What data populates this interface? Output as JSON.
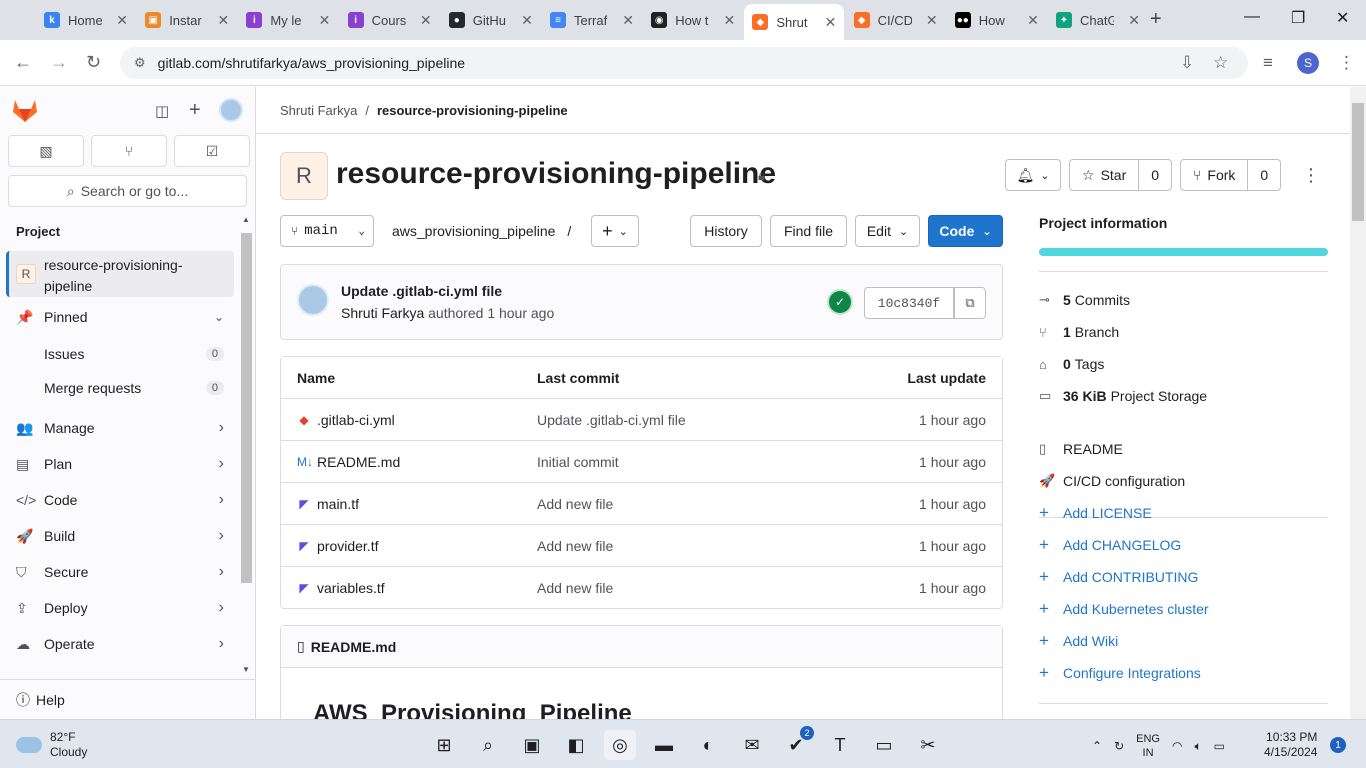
{
  "browser": {
    "tabs": [
      {
        "label": "Home",
        "icon": "k-icon",
        "color": "#3b82f6",
        "glyph": "k"
      },
      {
        "label": "Instar",
        "icon": "instance-icon",
        "color": "#ea8a2a",
        "glyph": "▣"
      },
      {
        "label": "My le",
        "icon": "learning-icon",
        "color": "#8b3fd1",
        "glyph": "i"
      },
      {
        "label": "Cours",
        "icon": "course-icon",
        "color": "#8b3fd1",
        "glyph": "i"
      },
      {
        "label": "GitHu",
        "icon": "github-icon",
        "color": "#24292f",
        "glyph": "●"
      },
      {
        "label": "Terraf",
        "icon": "docs-icon",
        "color": "#4285f4",
        "glyph": "≡"
      },
      {
        "label": "How t",
        "icon": "article-icon",
        "color": "#202124",
        "glyph": "◉"
      },
      {
        "label": "Shrut",
        "icon": "gitlab-icon",
        "color": "#fc6d26",
        "glyph": "◆"
      },
      {
        "label": "CI/CD",
        "icon": "gitlab-icon",
        "color": "#fc6d26",
        "glyph": "◆"
      },
      {
        "label": "How",
        "icon": "medium-icon",
        "color": "#000000",
        "glyph": "●●"
      },
      {
        "label": "ChatG",
        "icon": "chatgpt-icon",
        "color": "#10a37f",
        "glyph": "✦"
      }
    ],
    "active_tab": 7,
    "url": "gitlab.com/shrutifarkya/aws_provisioning_pipeline",
    "profile_initial": "S"
  },
  "sidebar": {
    "search_placeholder": "Search or go to...",
    "section_label": "Project",
    "project_badge": "R",
    "project_name": "resource-provisioning-pipeline",
    "pinned_label": "Pinned",
    "pinned_items": [
      {
        "label": "Issues",
        "count": "0"
      },
      {
        "label": "Merge requests",
        "count": "0"
      }
    ],
    "nav_items": [
      {
        "label": "Manage",
        "icon": "users-icon",
        "glyph": "👥"
      },
      {
        "label": "Plan",
        "icon": "plan-icon",
        "glyph": "▤"
      },
      {
        "label": "Code",
        "icon": "code-icon",
        "glyph": "</>"
      },
      {
        "label": "Build",
        "icon": "rocket-icon",
        "glyph": "🚀"
      },
      {
        "label": "Secure",
        "icon": "shield-icon",
        "glyph": "⛉"
      },
      {
        "label": "Deploy",
        "icon": "deploy-icon",
        "glyph": "⇪"
      },
      {
        "label": "Operate",
        "icon": "operate-icon",
        "glyph": "☁"
      }
    ],
    "help_label": "Help"
  },
  "main": {
    "breadcrumb": {
      "owner": "Shruti Farkya",
      "project": "resource-provisioning-pipeline"
    },
    "project_avatar": "R",
    "title": "resource-provisioning-pipeline",
    "notify_label": "",
    "star_label": "Star",
    "star_count": "0",
    "fork_label": "Fork",
    "fork_count": "0",
    "branch": "main",
    "path": "aws_provisioning_pipeline",
    "path_sep": "/",
    "history_label": "History",
    "find_file_label": "Find file",
    "edit_label": "Edit",
    "code_label": "Code",
    "last_commit": {
      "message": "Update .gitlab-ci.yml file",
      "author": "Shruti Farkya",
      "action": "authored",
      "time": "1 hour ago",
      "sha": "10c8340f"
    },
    "file_table": {
      "headers": {
        "name": "Name",
        "last_commit": "Last commit",
        "last_update": "Last update"
      },
      "rows": [
        {
          "name": ".gitlab-ci.yml",
          "commit": "Update .gitlab-ci.yml file",
          "updated": "1 hour ago",
          "icon": "gitlab-file-icon",
          "glyph": "◆",
          "color": "#e24329"
        },
        {
          "name": "README.md",
          "commit": "Initial commit",
          "updated": "1 hour ago",
          "icon": "markdown-icon",
          "glyph": "M↓",
          "color": "#1f75cb"
        },
        {
          "name": "main.tf",
          "commit": "Add new file",
          "updated": "1 hour ago",
          "icon": "terraform-icon",
          "glyph": "◤",
          "color": "#5c4ee5"
        },
        {
          "name": "provider.tf",
          "commit": "Add new file",
          "updated": "1 hour ago",
          "icon": "terraform-icon",
          "glyph": "◤",
          "color": "#5c4ee5"
        },
        {
          "name": "variables.tf",
          "commit": "Add new file",
          "updated": "1 hour ago",
          "icon": "terraform-icon",
          "glyph": "◤",
          "color": "#5c4ee5"
        }
      ]
    },
    "readme": {
      "filename": "README.md",
      "heading": "AWS_Provisioning_Pipeline"
    }
  },
  "project_info": {
    "title": "Project information",
    "stats": [
      {
        "value": "5",
        "label": "Commits",
        "icon": "commit-icon",
        "glyph": "⊸"
      },
      {
        "value": "1",
        "label": "Branch",
        "icon": "branch-icon",
        "glyph": "⑂"
      },
      {
        "value": "0",
        "label": "Tags",
        "icon": "tag-icon",
        "glyph": "⌂"
      },
      {
        "value": "36 KiB",
        "label": "Project Storage",
        "icon": "storage-icon",
        "glyph": "▭"
      }
    ],
    "docs": [
      {
        "label": "README",
        "icon": "file-icon",
        "glyph": "▯"
      },
      {
        "label": "CI/CD configuration",
        "icon": "rocket-icon",
        "glyph": "🚀"
      }
    ],
    "links": [
      {
        "label": "Add LICENSE"
      },
      {
        "label": "Add CHANGELOG"
      },
      {
        "label": "Add CONTRIBUTING"
      },
      {
        "label": "Add Kubernetes cluster"
      },
      {
        "label": "Add Wiki"
      },
      {
        "label": "Configure Integrations"
      }
    ]
  },
  "taskbar": {
    "weather_temp": "82°F",
    "weather_desc": "Cloudy",
    "lang_top": "ENG",
    "lang_bottom": "IN",
    "time": "10:33 PM",
    "date": "4/15/2024",
    "notification_count": "1",
    "apps": [
      {
        "icon": "windows-start-icon",
        "glyph": "⊞"
      },
      {
        "icon": "search-icon",
        "glyph": "⌕"
      },
      {
        "icon": "task-view-icon",
        "glyph": "▣"
      },
      {
        "icon": "meet-icon",
        "glyph": "◧"
      },
      {
        "icon": "chrome-icon",
        "glyph": "◎"
      },
      {
        "icon": "file-explorer-icon",
        "glyph": "▬"
      },
      {
        "icon": "edge-icon",
        "glyph": "◐"
      },
      {
        "icon": "outlook-icon",
        "glyph": "✉"
      },
      {
        "icon": "todo-icon",
        "glyph": "✔"
      },
      {
        "icon": "teams-icon",
        "glyph": "T"
      },
      {
        "icon": "terminal-icon",
        "glyph": "▭"
      },
      {
        "icon": "snipping-icon",
        "glyph": "✂"
      }
    ],
    "todo_badge": "2"
  }
}
